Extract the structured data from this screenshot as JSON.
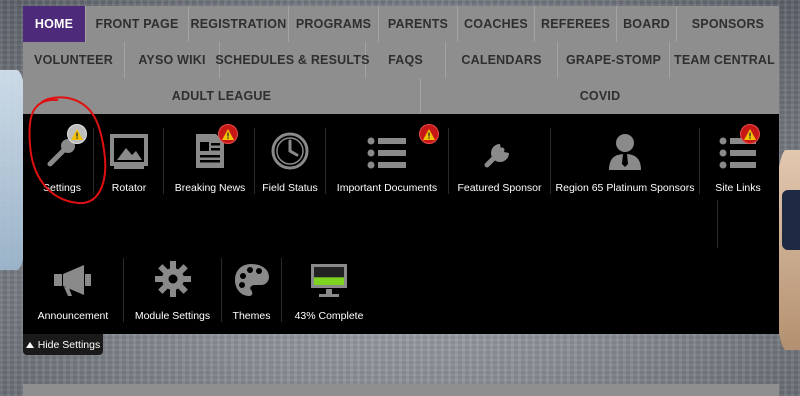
{
  "nav": {
    "row1": [
      "HOME",
      "FRONT PAGE",
      "REGISTRATION",
      "PROGRAMS",
      "PARENTS",
      "COACHES",
      "REFEREES",
      "BOARD",
      "SPONSORS"
    ],
    "row2": [
      "VOLUNTEER",
      "AYSO WIKI",
      "SCHEDULES & RESULTS",
      "FAQS",
      "CALENDARS",
      "GRAPE-STOMP",
      "TEAM CENTRAL"
    ],
    "row3": [
      "ADULT LEAGUE",
      "COVID"
    ],
    "active": "HOME"
  },
  "modules": {
    "settings": "Settings",
    "rotator": "Rotator",
    "breaking_news": "Breaking News",
    "field_status": "Field Status",
    "important_documents": "Important Documents",
    "featured_sponsor": "Featured Sponsor",
    "region_sponsors": "Region 65 Platinum Sponsors",
    "site_links": "Site Links",
    "announcement": "Announcement",
    "module_settings": "Module Settings",
    "themes": "Themes",
    "progress": "43% Complete"
  },
  "progress_value": 0.43,
  "hide_settings": "Hide Settings",
  "colors": {
    "nav_bg": "#8e8e8e",
    "nav_active": "#4e2b7a",
    "panel_bg": "#000000",
    "warning_red": "#c71818",
    "progress_green": "#7ed321",
    "annotation_red": "#e01010"
  }
}
